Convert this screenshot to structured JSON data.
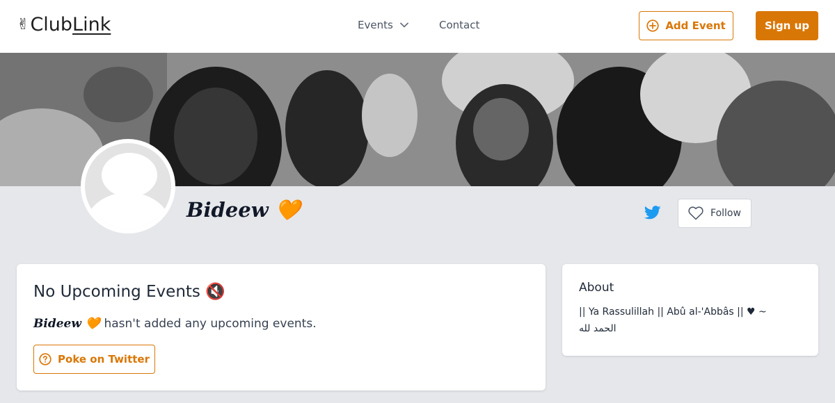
{
  "header": {
    "logo_text": "ClubLink",
    "logo_text_main": "Club",
    "logo_text_link": "Link",
    "logo_emoji": "✌",
    "nav": {
      "events_label": "Events",
      "contact_label": "Contact"
    },
    "add_event_label": "Add Event",
    "sign_up_label": "Sign up"
  },
  "profile": {
    "name": "Bideew 🧡",
    "follow_label": "Follow"
  },
  "events_card": {
    "title": "No Upcoming Events 🔇",
    "description_name": "Bideew 🧡",
    "description_text": " hasn't added any upcoming events.",
    "poke_label": "Poke on Twitter"
  },
  "about_card": {
    "title": "About",
    "text": "|| Ya Rassulillah  || Abû al-'Abbâs || ♥ ~ الحمد لله"
  },
  "colors": {
    "accent": "#d97706",
    "twitter": "#1d9bf0",
    "page_bg": "#e5e7eb"
  }
}
